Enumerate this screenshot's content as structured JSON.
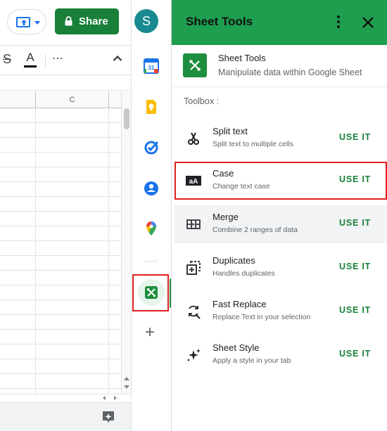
{
  "topbar": {
    "share_label": "Share",
    "avatar_initial": "S",
    "present_icon": "present-screen-icon",
    "lock_icon": "lock-icon"
  },
  "format_bar": {
    "textcolor_glyph": "A",
    "more_glyph": "⋯"
  },
  "grid": {
    "column_headers": [
      "",
      "C"
    ]
  },
  "side_apps": [
    "calendar-icon",
    "keep-icon",
    "tasks-icon",
    "contacts-icon",
    "maps-icon"
  ],
  "calendar_day": "31",
  "panel": {
    "title": "Sheet Tools",
    "app_name": "Sheet Tools",
    "app_description": "Manipulate data within Google Sheet",
    "toolbox_label": "Toolbox :",
    "action_label": "USE IT",
    "tools": [
      {
        "name": "Split text",
        "description": "Split text to multiple cells",
        "icon": "scissors-icon"
      },
      {
        "name": "Case",
        "description": "Change text case",
        "icon": "text-case-icon"
      },
      {
        "name": "Merge",
        "description": "Combine 2 ranges of data",
        "icon": "merge-icon"
      },
      {
        "name": "Duplicates",
        "description": "Handles duplicates",
        "icon": "duplicates-icon"
      },
      {
        "name": "Fast Replace",
        "description": "Replace Text in your selection",
        "icon": "find-replace-icon"
      },
      {
        "name": "Sheet Style",
        "description": "Apply a style in your tab",
        "icon": "sparkle-icon"
      }
    ]
  },
  "colors": {
    "brand_green": "#1e9e4f",
    "share_green": "#188038",
    "highlight_red": "#e02020",
    "avatar_teal": "#1a8a91"
  }
}
